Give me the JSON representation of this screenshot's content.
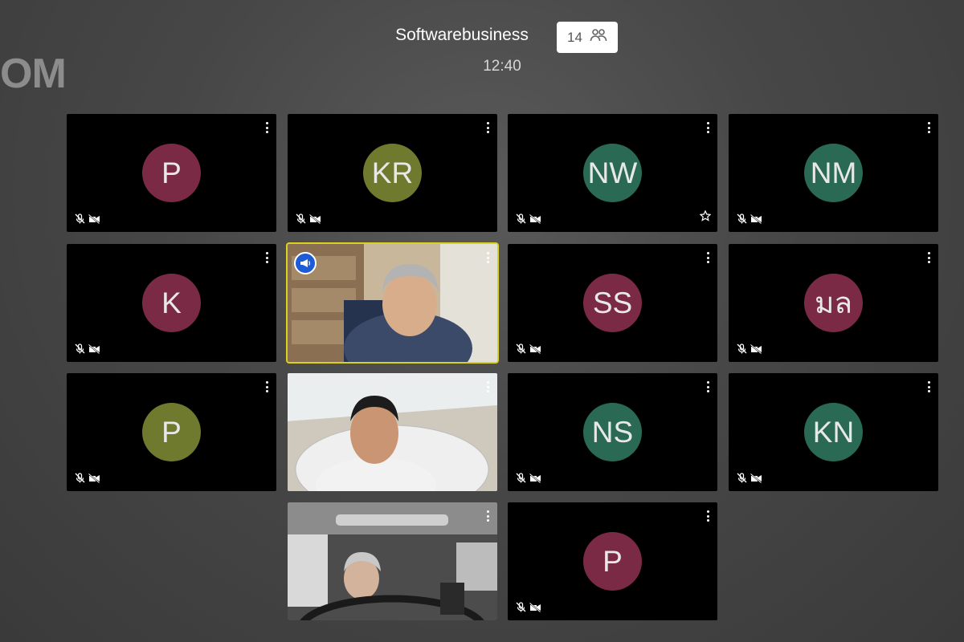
{
  "logo_text": "OM",
  "meeting": {
    "title": "Softwarebusiness",
    "participant_count": "14",
    "timer": "12:40"
  },
  "tiles": [
    {
      "initials": "P",
      "color": "#7a2a45",
      "type": "avatar"
    },
    {
      "initials": "KR",
      "color": "#6f7a2e",
      "type": "avatar"
    },
    {
      "initials": "NW",
      "color": "#2a6a55",
      "type": "avatar",
      "starred": true
    },
    {
      "initials": "NM",
      "color": "#2a6a55",
      "type": "avatar"
    },
    {
      "initials": "K",
      "color": "#7a2a45",
      "type": "avatar"
    },
    {
      "type": "video",
      "speaking": true
    },
    {
      "initials": "SS",
      "color": "#7a2a45",
      "type": "avatar"
    },
    {
      "initials": "มล",
      "color": "#7a2a45",
      "type": "avatar"
    },
    {
      "initials": "P",
      "color": "#6f7a2e",
      "type": "avatar"
    },
    {
      "type": "video"
    },
    {
      "initials": "NS",
      "color": "#2a6a55",
      "type": "avatar"
    },
    {
      "initials": "KN",
      "color": "#2a6a55",
      "type": "avatar"
    },
    {
      "type": "video"
    },
    {
      "initials": "P",
      "color": "#7a2a45",
      "type": "avatar"
    }
  ],
  "icons": {
    "participants": "people-icon",
    "mic": "mic-off-icon",
    "camera": "camera-off-icon",
    "menu": "more-vertical-icon",
    "star": "star-icon",
    "speaker": "megaphone-icon"
  }
}
